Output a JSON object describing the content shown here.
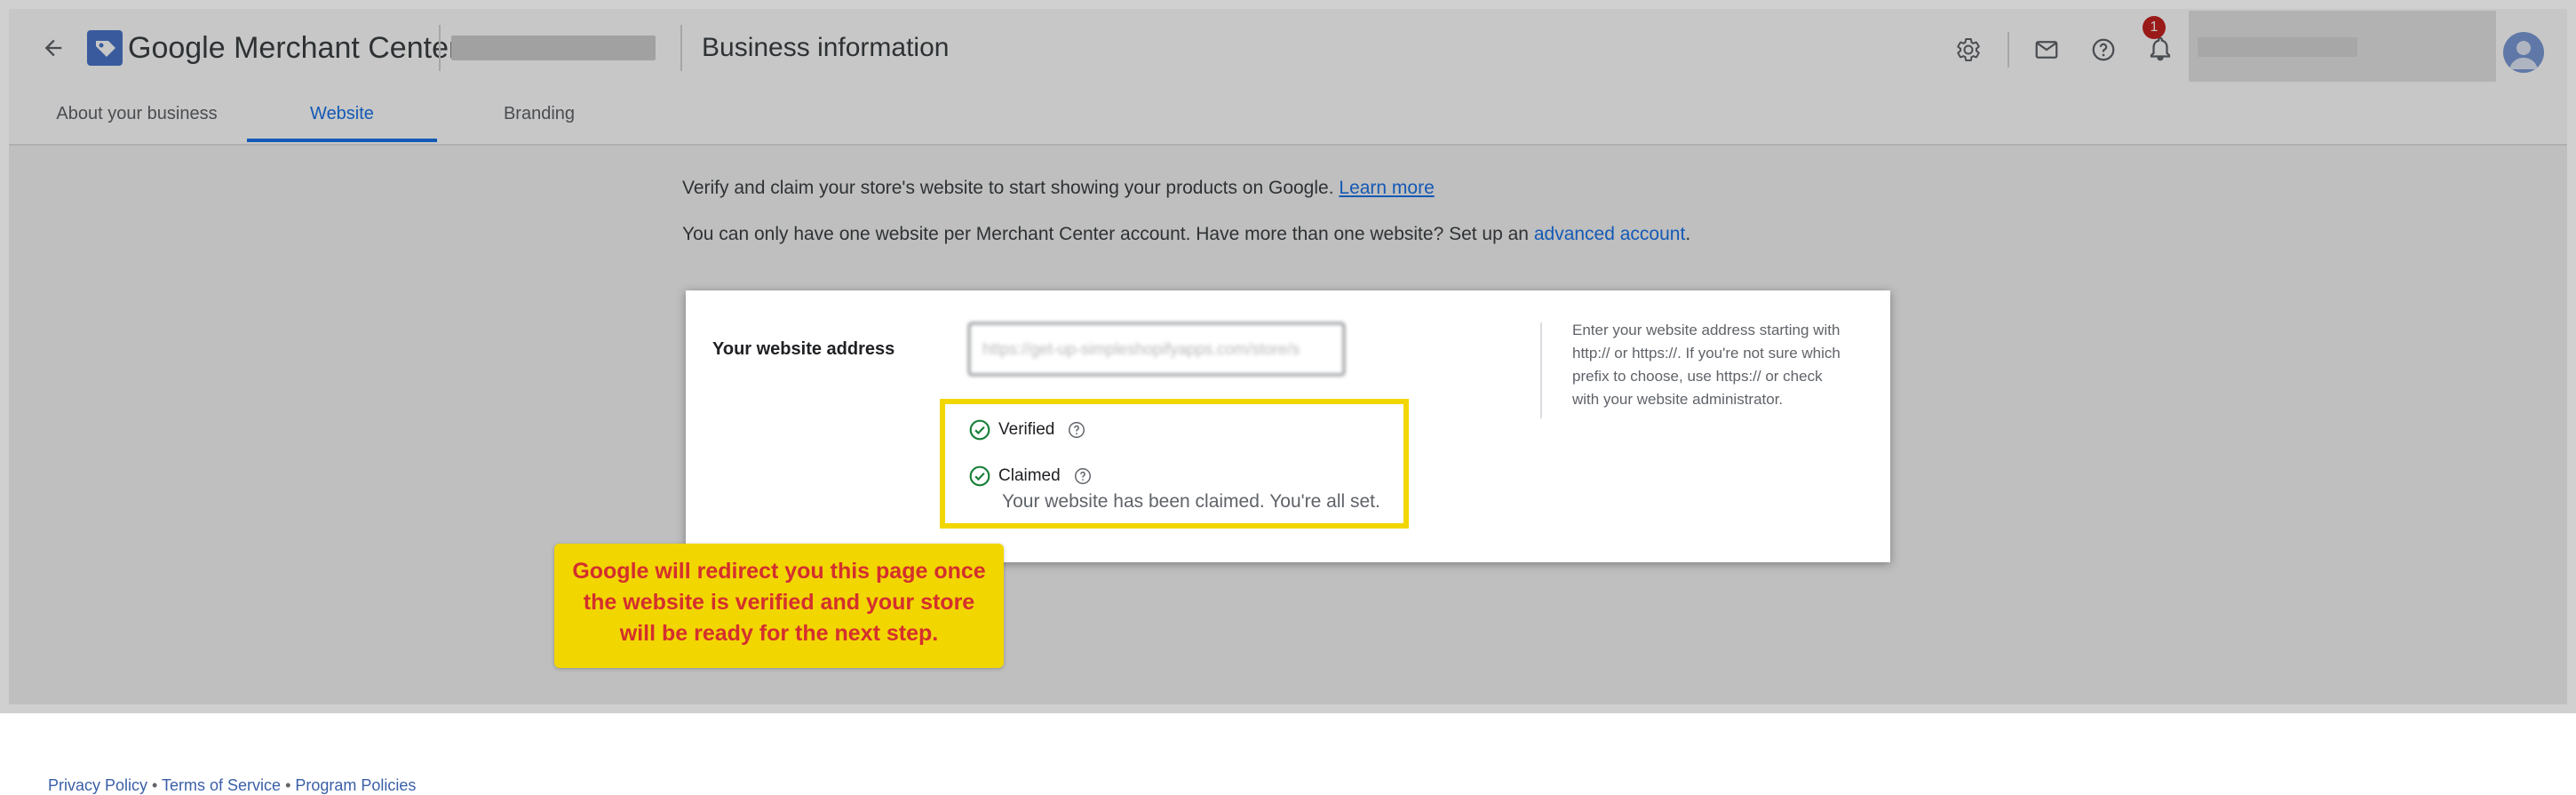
{
  "header": {
    "brand": "Google Merchant Center",
    "page_title": "Business information",
    "notification_count": "1"
  },
  "tabs": [
    {
      "label": "About your business",
      "active": false
    },
    {
      "label": "Website",
      "active": true
    },
    {
      "label": "Branding",
      "active": false
    }
  ],
  "intro": {
    "line1": "Verify and claim your store's website to start showing your products on Google.",
    "line1_link": "Learn more",
    "line2": "You can only have one website per Merchant Center account. Have more than one website? Set up an",
    "line2_link": "advanced account",
    "line2_end": "."
  },
  "website_card": {
    "field_label": "Your website address",
    "field_value": "https://get-up-simpleshopifyapps.com/store/s",
    "help_text": "Enter your website address starting with http:// or https://. If you're not sure which prefix to choose, use https:// or check with your website administrator."
  },
  "status": {
    "verified_label": "Verified",
    "claimed_label": "Claimed",
    "claimed_note": "Your website has been claimed. You're all set."
  },
  "callout": {
    "text": "Google will redirect you this page once the website is verified and your store will be ready for the next step."
  },
  "footer": {
    "privacy": "Privacy Policy",
    "terms": "Terms of Service",
    "program": "Program Policies",
    "separator": " • "
  },
  "colors": {
    "accent": "#1a73e8",
    "highlight": "#f2d600",
    "callout_text": "#d32f2f",
    "success": "#188038",
    "badge": "#c5221f"
  },
  "icons": [
    "back-arrow-icon",
    "merchant-center-logo",
    "settings-icon",
    "mail-icon",
    "help-icon",
    "notifications-icon",
    "account-avatar",
    "check-circle-icon",
    "help-circle-icon"
  ]
}
